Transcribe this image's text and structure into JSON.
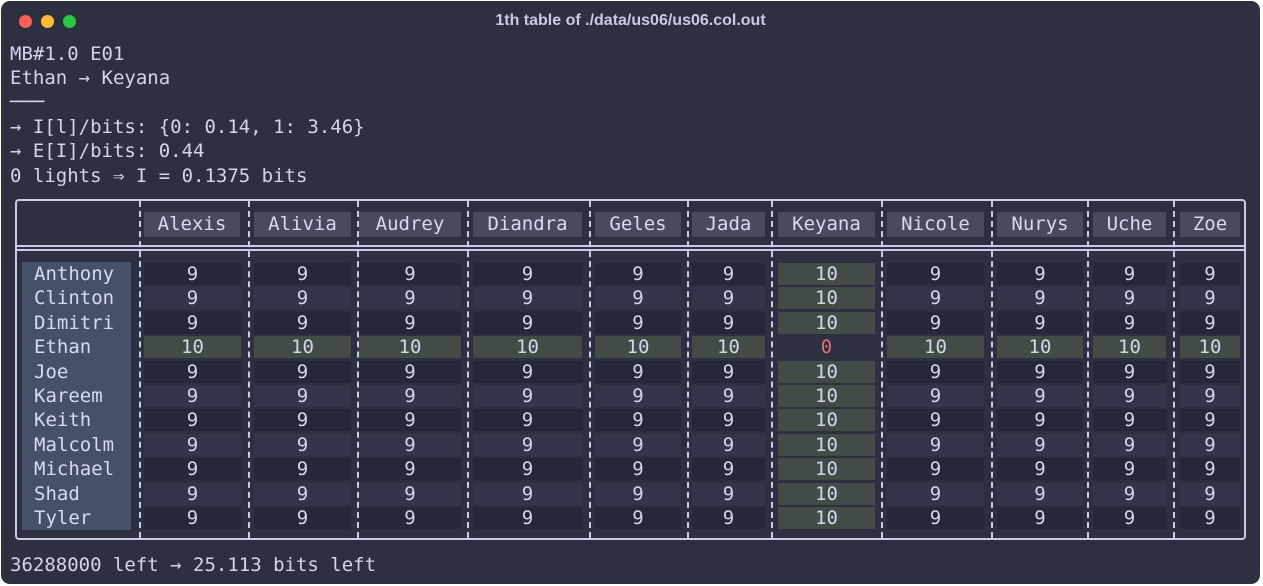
{
  "window": {
    "title": "1th table of ./data/us06/us06.col.out"
  },
  "header_lines": [
    "MB#1.0 E01",
    "Ethan → Keyana",
    "───",
    "→ I[l]/bits: {0: 0.14, 1: 3.46}",
    "→ E[I]/bits: 0.44",
    "0 lights ⇒ I = 0.1375 bits"
  ],
  "table": {
    "columns": [
      "Alexis",
      "Alivia",
      "Audrey",
      "Diandra",
      "Geles",
      "Jada",
      "Keyana",
      "Nicole",
      "Nurys",
      "Uche",
      "Zoe"
    ],
    "rows": [
      {
        "name": "Anthony",
        "values": [
          "9",
          "9",
          "9",
          "9",
          "9",
          "9",
          "10",
          "9",
          "9",
          "9",
          "9"
        ]
      },
      {
        "name": "Clinton",
        "values": [
          "9",
          "9",
          "9",
          "9",
          "9",
          "9",
          "10",
          "9",
          "9",
          "9",
          "9"
        ]
      },
      {
        "name": "Dimitri",
        "values": [
          "9",
          "9",
          "9",
          "9",
          "9",
          "9",
          "10",
          "9",
          "9",
          "9",
          "9"
        ]
      },
      {
        "name": "Ethan",
        "values": [
          "10",
          "10",
          "10",
          "10",
          "10",
          "10",
          "0",
          "10",
          "10",
          "10",
          "10"
        ]
      },
      {
        "name": "Joe",
        "values": [
          "9",
          "9",
          "9",
          "9",
          "9",
          "9",
          "10",
          "9",
          "9",
          "9",
          "9"
        ]
      },
      {
        "name": "Kareem",
        "values": [
          "9",
          "9",
          "9",
          "9",
          "9",
          "9",
          "10",
          "9",
          "9",
          "9",
          "9"
        ]
      },
      {
        "name": "Keith",
        "values": [
          "9",
          "9",
          "9",
          "9",
          "9",
          "9",
          "10",
          "9",
          "9",
          "9",
          "9"
        ]
      },
      {
        "name": "Malcolm",
        "values": [
          "9",
          "9",
          "9",
          "9",
          "9",
          "9",
          "10",
          "9",
          "9",
          "9",
          "9"
        ]
      },
      {
        "name": "Michael",
        "values": [
          "9",
          "9",
          "9",
          "9",
          "9",
          "9",
          "10",
          "9",
          "9",
          "9",
          "9"
        ]
      },
      {
        "name": "Shad",
        "values": [
          "9",
          "9",
          "9",
          "9",
          "9",
          "9",
          "10",
          "9",
          "9",
          "9",
          "9"
        ]
      },
      {
        "name": "Tyler",
        "values": [
          "9",
          "9",
          "9",
          "9",
          "9",
          "9",
          "10",
          "9",
          "9",
          "9",
          "9"
        ]
      }
    ],
    "highlight_row": "Ethan",
    "highlight_column": "Keyana"
  },
  "footer": "36288000 left → 25.113 bits left",
  "colors": {
    "background": "#2d3041",
    "highlight": "#424b46",
    "zero": "#e07070"
  }
}
